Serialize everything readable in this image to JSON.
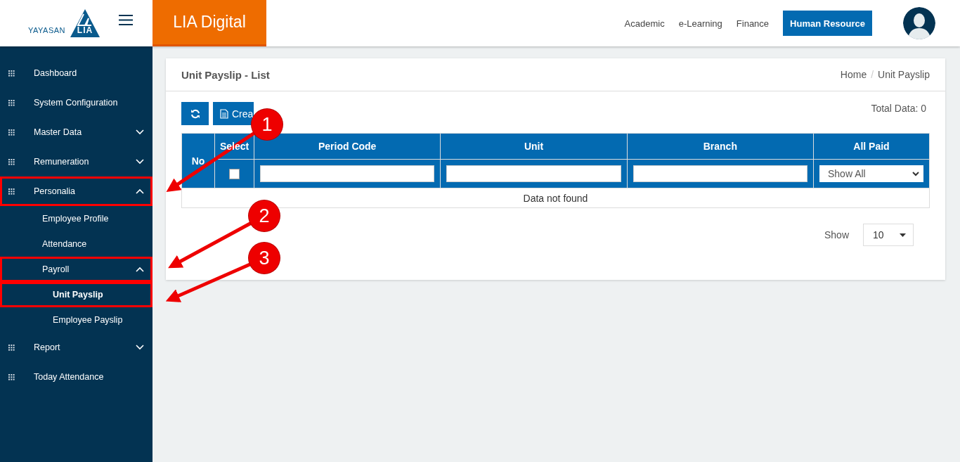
{
  "header": {
    "logo_text": "YAYASAN",
    "logo_mark": "LIA",
    "app_title": "LIA Digital",
    "nav": [
      {
        "label": "Academic",
        "selected": false
      },
      {
        "label": "e-Learning",
        "selected": false
      },
      {
        "label": "Finance",
        "selected": false
      },
      {
        "label": "Human Resource",
        "selected": true
      }
    ]
  },
  "sidebar": {
    "items": [
      {
        "label": "Dashboard",
        "highlighted": false
      },
      {
        "label": "System Configuration",
        "highlighted": false
      },
      {
        "label": "Master Data",
        "expanded": false,
        "highlighted": false
      },
      {
        "label": "Remuneration",
        "expanded": false,
        "highlighted": false
      },
      {
        "label": "Personalia",
        "expanded": true,
        "highlighted": true,
        "children": [
          {
            "label": "Employee Profile",
            "highlighted": false,
            "selected": false
          },
          {
            "label": "Attendance",
            "highlighted": false,
            "selected": false
          },
          {
            "label": "Payroll",
            "expanded": true,
            "highlighted": true,
            "selected": false,
            "children": [
              {
                "label": "Unit Payslip",
                "highlighted": true,
                "selected": true
              },
              {
                "label": "Employee Payslip",
                "highlighted": false,
                "selected": false
              }
            ]
          }
        ]
      },
      {
        "label": "Report",
        "expanded": false,
        "highlighted": false
      },
      {
        "label": "Today Attendance",
        "highlighted": false
      }
    ]
  },
  "page": {
    "title": "Unit Payslip - List",
    "breadcrumb": [
      "Home",
      "Unit Payslip"
    ],
    "breadcrumb_separator": "/",
    "create_button": "Crea",
    "total": "Total Data: 0",
    "table": {
      "columns": [
        "No",
        "Select",
        "Period Code",
        "Unit",
        "Branch",
        "All Paid"
      ],
      "select_all_checked": false,
      "all_paid_filter": "Show All",
      "empty_message": "Data not found"
    },
    "page_size_label": "Show",
    "page_size": "10"
  },
  "callouts": [
    {
      "number": "1"
    },
    {
      "number": "2"
    },
    {
      "number": "3"
    }
  ]
}
